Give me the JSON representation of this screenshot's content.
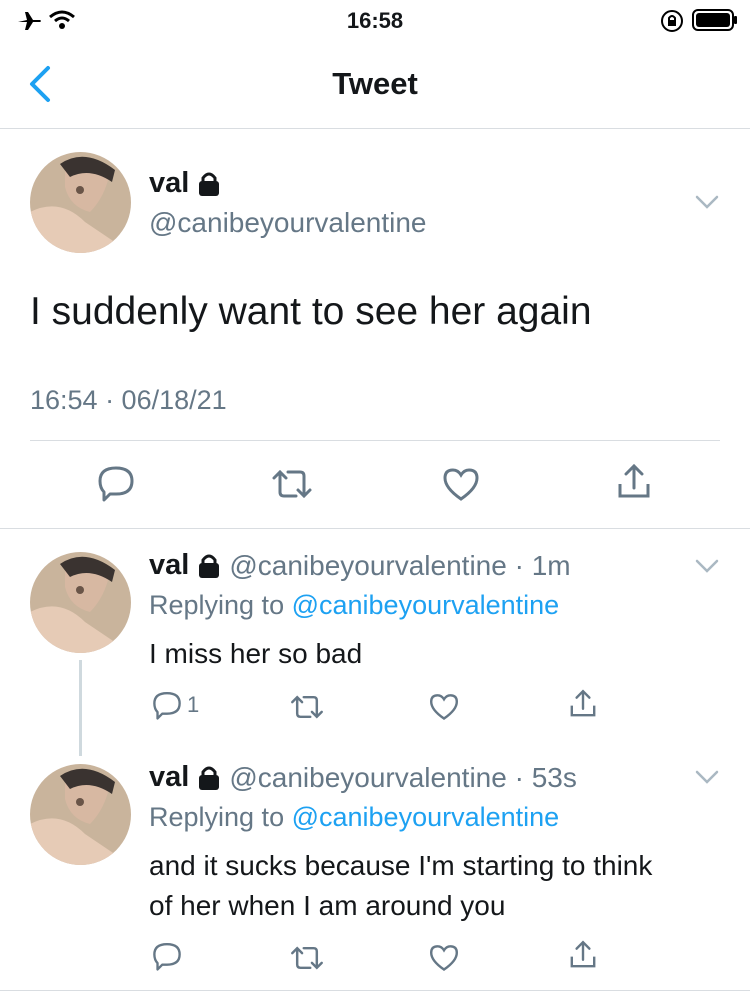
{
  "status_bar": {
    "time": "16:58"
  },
  "nav": {
    "title": "Tweet"
  },
  "main_tweet": {
    "name": "val",
    "handle": "@canibeyourvalentine",
    "text": "I suddenly want to see her again",
    "timestamp": "16:54 · 06/18/21"
  },
  "replies": [
    {
      "name": "val",
      "handle": "@canibeyourvalentine · 1m",
      "replying_prefix": "Replying to ",
      "replying_handle": "@canibeyourvalentine",
      "text": "I miss her so bad",
      "reply_count": "1"
    },
    {
      "name": "val",
      "handle": "@canibeyourvalentine · 53s",
      "replying_prefix": "Replying to ",
      "replying_handle": "@canibeyourvalentine",
      "text_line1": "and it sucks because I'm starting to think",
      "text_line2": "of her when I am around you"
    }
  ],
  "colors": {
    "accent": "#1da1f2",
    "icon": "#657786",
    "separator": "#d9dde1"
  }
}
